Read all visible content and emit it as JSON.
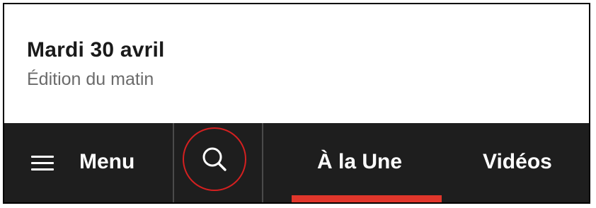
{
  "header": {
    "date": "Mardi 30 avril",
    "edition": "Édition du matin"
  },
  "nav": {
    "menu_label": "Menu",
    "menu_icon": "hamburger-icon",
    "search_icon": "search-icon",
    "tabs": [
      {
        "label": "À la Une",
        "active": true
      },
      {
        "label": "Vidéos",
        "active": false
      }
    ]
  },
  "colors": {
    "nav_background": "#1e1e1e",
    "active_tab_underline": "#e0362b",
    "search_highlight": "#d42020",
    "edition_text": "#6b6b6b"
  }
}
